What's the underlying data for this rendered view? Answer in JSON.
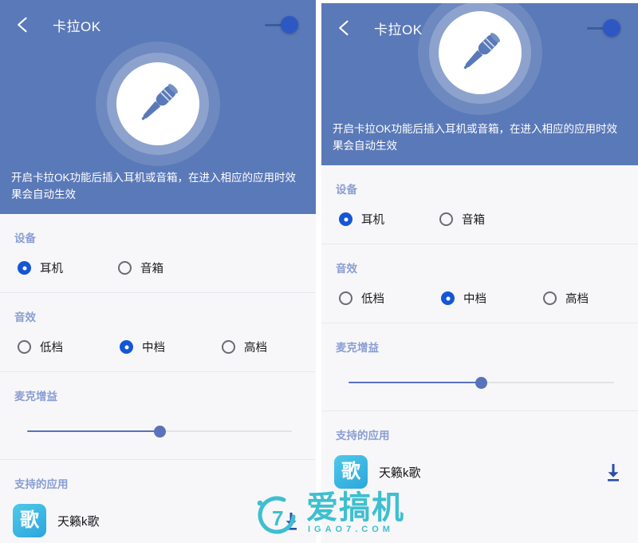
{
  "meta": {
    "colors": {
      "hero_blue": "#5a79b8",
      "section_header": "#8a9ed4",
      "radio_selected": "#1556d6",
      "slider_blue": "#5a72ba",
      "toggle_thumb": "#2d58c4",
      "page_bg": "#f7f7f9",
      "watermark": "#3ebfcf"
    }
  },
  "header": {
    "back_icon": "arrow-left-icon",
    "title": "卡拉OK",
    "toggle_icon": "power-switch-toggle",
    "toggle_state": "on",
    "hero_icon": "microphone-icon"
  },
  "description": "开启卡拉OK功能后插入耳机或音箱，在进入相应的应用时效果会自动生效",
  "sections": {
    "device": {
      "title": "设备",
      "options": [
        {
          "label": "耳机",
          "selected": true
        },
        {
          "label": "音箱",
          "selected": false
        }
      ]
    },
    "effect": {
      "title": "音效",
      "options": [
        {
          "label": "低档",
          "selected": false
        },
        {
          "label": "中档",
          "selected": true
        },
        {
          "label": "高档",
          "selected": false
        }
      ]
    },
    "mic_gain": {
      "title": "麦克增益",
      "slider_percent": 50
    },
    "supported_apps": {
      "title": "支持的应用",
      "apps": [
        {
          "name": "天籁k歌",
          "icon_glyph": "歌",
          "icon_name": "app-icon-tianlai-kge",
          "action_icon": "download-icon"
        }
      ]
    }
  },
  "watermark": {
    "brand": "爱搞机",
    "domain": "IGAO7.COM",
    "logo": "i7-circle-logo"
  }
}
